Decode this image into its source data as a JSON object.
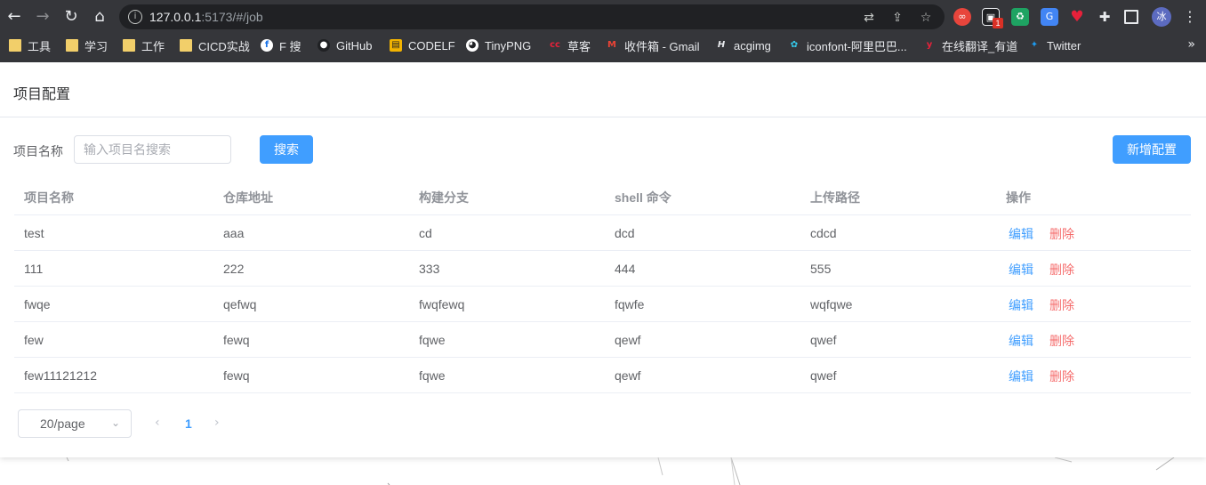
{
  "browser": {
    "url_host": "127.0.0.1",
    "url_rest": ":5173/#/job",
    "ext_badge": "1",
    "profile_initial": "冰",
    "bookmarks": [
      "工具",
      "学习",
      "工作",
      "CICD实战",
      "F 搜",
      "GitHub",
      "CODELF",
      "TinyPNG",
      "草客",
      "收件箱 - Gmail",
      "acgimg",
      "iconfont-阿里巴巴...",
      "在线翻译_有道",
      "Twitter"
    ],
    "bookmark_more": "»"
  },
  "page": {
    "title": "项目配置",
    "filter_label": "项目名称",
    "search_placeholder": "输入项目名搜索",
    "search_button": "搜索",
    "add_button": "新增配置"
  },
  "table": {
    "headers": [
      "项目名称",
      "仓库地址",
      "构建分支",
      "shell 命令",
      "上传路径",
      "操作"
    ],
    "rows": [
      {
        "name": "test",
        "repo": "aaa",
        "branch": "cd",
        "shell": "dcd",
        "path": "cdcd"
      },
      {
        "name": "111",
        "repo": "222",
        "branch": "333",
        "shell": "444",
        "path": "555"
      },
      {
        "name": "fwqe",
        "repo": "qefwq",
        "branch": "fwqfewq",
        "shell": "fqwfe",
        "path": "wqfqwe"
      },
      {
        "name": "few",
        "repo": "fewq",
        "branch": "fqwe",
        "shell": "qewf",
        "path": "qwef"
      },
      {
        "name": "few11121212",
        "repo": "fewq",
        "branch": "fqwe",
        "shell": "qewf",
        "path": "qwef"
      }
    ],
    "edit_label": "编辑",
    "delete_label": "删除"
  },
  "pagination": {
    "page_size": "20/page",
    "current_page": "1",
    "prev": "‹",
    "next": "›",
    "dropdown_arrow": "⌄"
  },
  "colors": {
    "primary": "#409eff",
    "danger": "#f56c6c",
    "chrome_bg": "#35363a"
  }
}
